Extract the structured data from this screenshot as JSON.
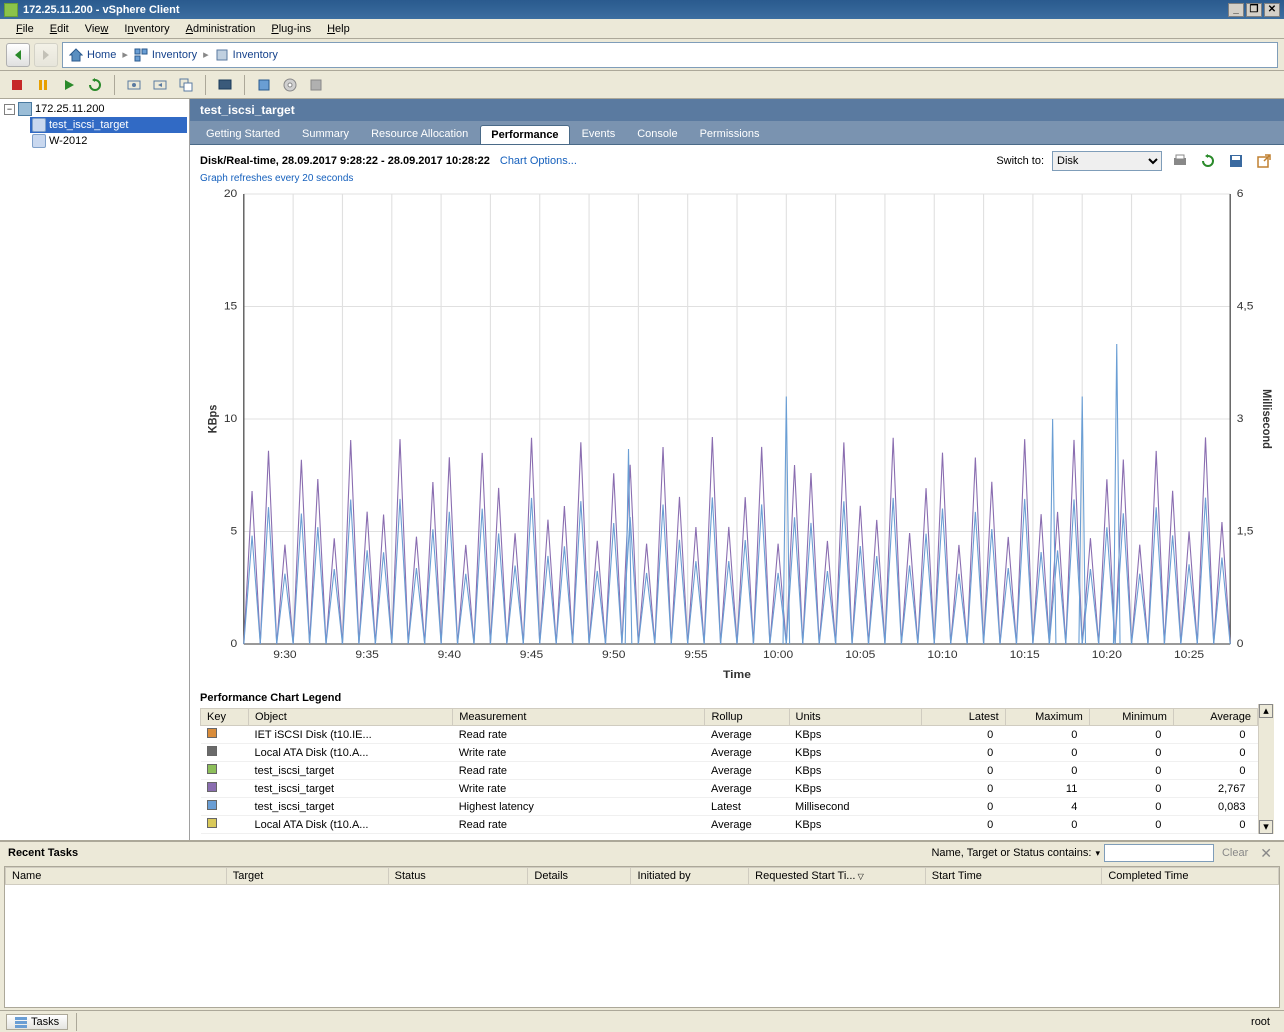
{
  "window": {
    "title": "172.25.11.200 - vSphere Client"
  },
  "menu": [
    "File",
    "Edit",
    "View",
    "Inventory",
    "Administration",
    "Plug-ins",
    "Help"
  ],
  "breadcrumb": {
    "home": "Home",
    "inventory": "Inventory",
    "inventory2": "Inventory"
  },
  "tree": {
    "host": "172.25.11.200",
    "vm1": "test_iscsi_target",
    "vm2": "W-2012"
  },
  "page_title": "test_iscsi_target",
  "tabs": [
    "Getting Started",
    "Summary",
    "Resource Allocation",
    "Performance",
    "Events",
    "Console",
    "Permissions"
  ],
  "perf": {
    "title": "Disk/Real-time, 28.09.2017 9:28:22 - 28.09.2017 10:28:22",
    "chart_options": "Chart Options...",
    "refresh_note": "Graph refreshes every 20 seconds",
    "switch_label": "Switch to:",
    "switch_value": "Disk"
  },
  "chart_data": {
    "type": "line",
    "xlabel": "Time",
    "ylabel_left": "KBps",
    "ylabel_right": "Millisecond",
    "ylim_left": [
      0,
      20
    ],
    "ylim_right": [
      0,
      6
    ],
    "yticks_left": [
      0,
      5,
      10,
      15,
      20
    ],
    "yticks_right": [
      0,
      1.5,
      3,
      4.5,
      6
    ],
    "xticks": [
      "9:30",
      "9:35",
      "9:40",
      "9:45",
      "9:50",
      "9:55",
      "10:00",
      "10:05",
      "10:10",
      "10:15",
      "10:20",
      "10:25"
    ],
    "series": [
      {
        "name": "test_iscsi_target Write rate",
        "axis": "left",
        "color": "#8a6db0",
        "pattern": "periodic-spikes",
        "period_s": 60,
        "peak": 8,
        "base": 0
      },
      {
        "name": "test_iscsi_target Highest latency",
        "axis": "right",
        "color": "#6a9ed4",
        "pattern": "periodic-spikes",
        "period_s": 60,
        "peak": 1.7,
        "base": 0,
        "outliers": [
          {
            "x": "9:52",
            "y": 2.6
          },
          {
            "x": "10:02",
            "y": 3.3
          },
          {
            "x": "10:19",
            "y": 3.3
          },
          {
            "x": "10:21",
            "y": 3.0
          },
          {
            "x": "10:23",
            "y": 4.0
          }
        ]
      }
    ]
  },
  "legend": {
    "title": "Performance Chart Legend",
    "headers": [
      "Key",
      "Object",
      "Measurement",
      "Rollup",
      "Units",
      "Latest",
      "Maximum",
      "Minimum",
      "Average"
    ],
    "rows": [
      {
        "color": "#d98c3a",
        "object": "IET iSCSI Disk (t10.IE...",
        "measurement": "Read rate",
        "rollup": "Average",
        "units": "KBps",
        "latest": "0",
        "max": "0",
        "min": "0",
        "avg": "0"
      },
      {
        "color": "#6a6a6a",
        "object": "Local ATA Disk (t10.A...",
        "measurement": "Write rate",
        "rollup": "Average",
        "units": "KBps",
        "latest": "0",
        "max": "0",
        "min": "0",
        "avg": "0"
      },
      {
        "color": "#8dbf5a",
        "object": "test_iscsi_target",
        "measurement": "Read rate",
        "rollup": "Average",
        "units": "KBps",
        "latest": "0",
        "max": "0",
        "min": "0",
        "avg": "0"
      },
      {
        "color": "#8a6db0",
        "object": "test_iscsi_target",
        "measurement": "Write rate",
        "rollup": "Average",
        "units": "KBps",
        "latest": "0",
        "max": "11",
        "min": "0",
        "avg": "2,767"
      },
      {
        "color": "#6a9ed4",
        "object": "test_iscsi_target",
        "measurement": "Highest latency",
        "rollup": "Latest",
        "units": "Millisecond",
        "latest": "0",
        "max": "4",
        "min": "0",
        "avg": "0,083"
      },
      {
        "color": "#d9c95a",
        "object": "Local ATA Disk (t10.A...",
        "measurement": "Read rate",
        "rollup": "Average",
        "units": "KBps",
        "latest": "0",
        "max": "0",
        "min": "0",
        "avg": "0"
      }
    ]
  },
  "recent_tasks": {
    "title": "Recent Tasks",
    "filter_label": "Name, Target or Status contains:",
    "clear": "Clear",
    "headers": [
      "Name",
      "Target",
      "Status",
      "Details",
      "Initiated by",
      "Requested Start Ti...",
      "Start Time",
      "Completed Time"
    ]
  },
  "status": {
    "tasks_btn": "Tasks",
    "user": "root"
  }
}
